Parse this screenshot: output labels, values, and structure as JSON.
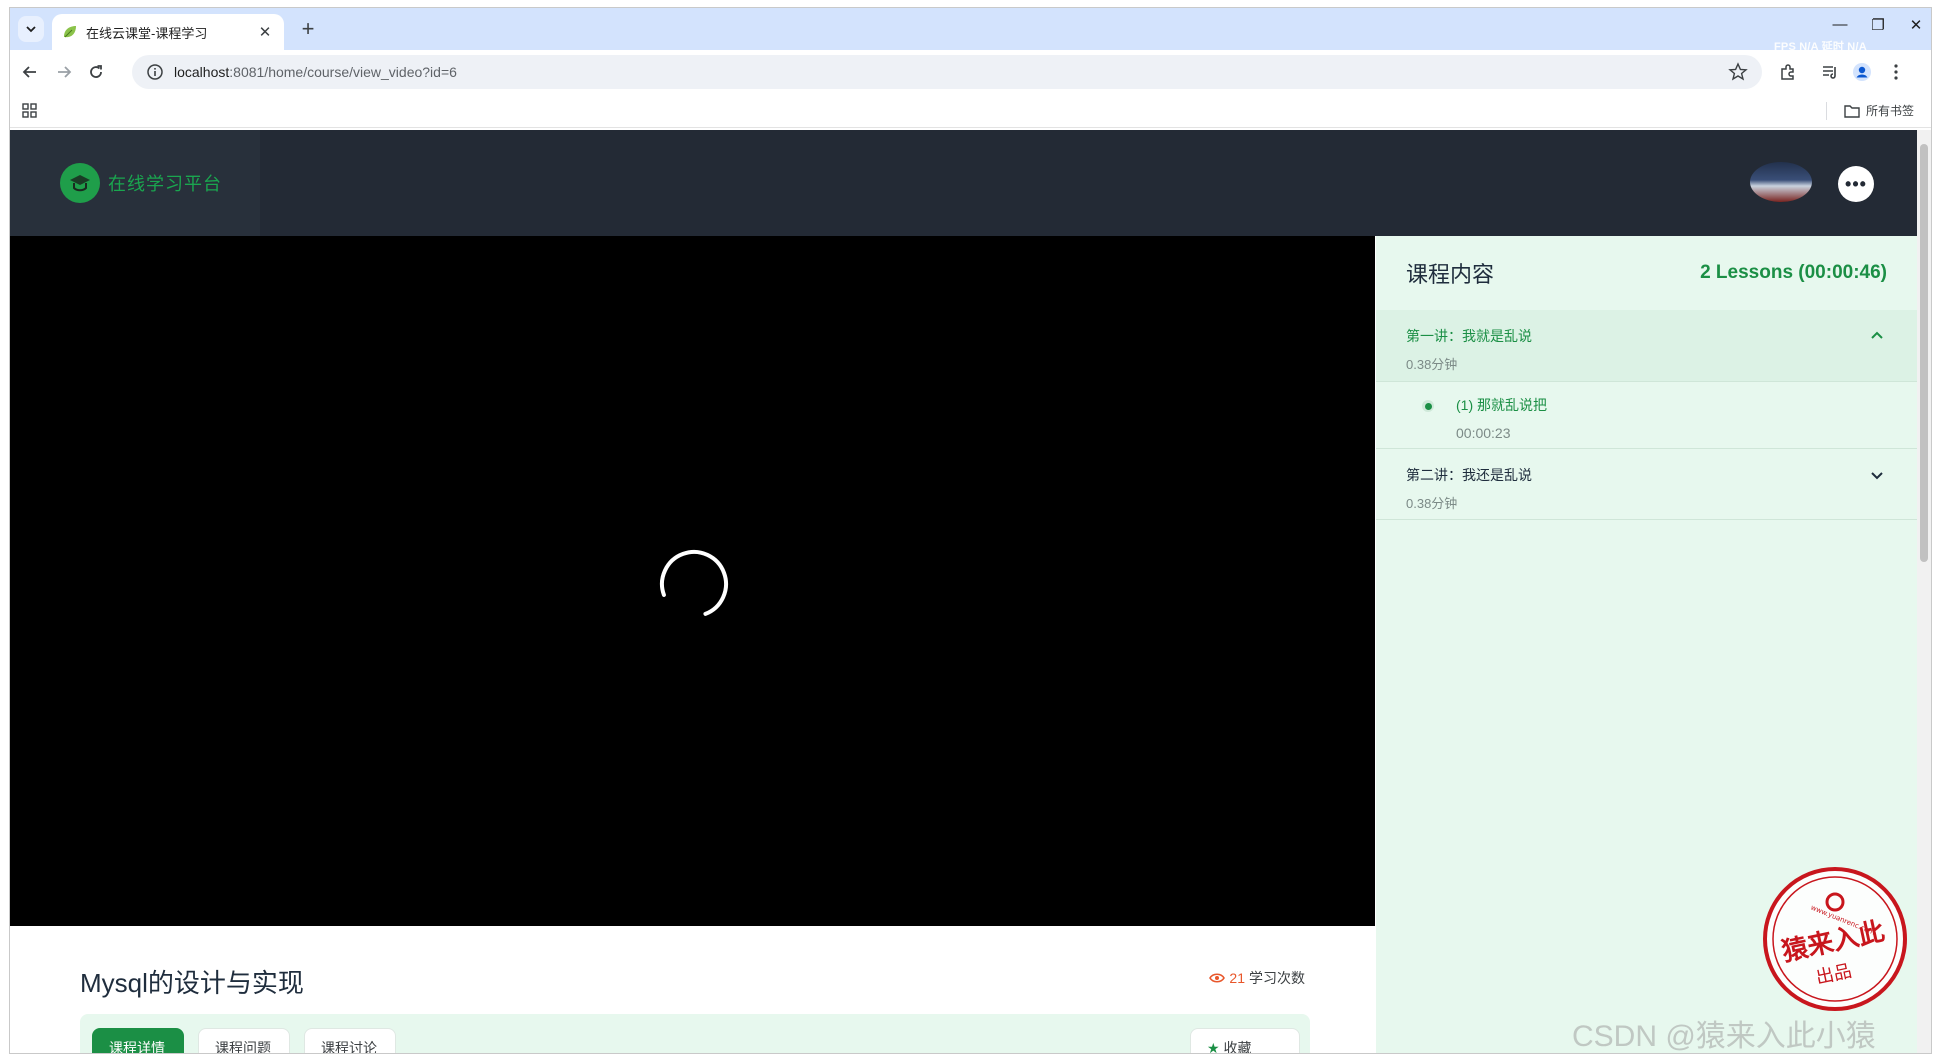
{
  "browser": {
    "tab_title": "在线云课堂-课程学习",
    "url_host": "localhost",
    "url_rest": ":8081/home/course/view_video?id=6",
    "fps_overlay": "FPS N/A 延时 N/A",
    "bookmarks_all": "所有书签",
    "icons": [
      "chevron-down-icon",
      "leaf-favicon",
      "close-icon",
      "plus-icon",
      "back-icon",
      "forward-icon",
      "reload-icon",
      "info-icon",
      "star-icon",
      "extensions-icon",
      "media-icon",
      "profile-icon",
      "kebab-icon",
      "apps-icon",
      "folder-icon"
    ]
  },
  "site": {
    "brand_name": "在线学习平台",
    "more_label": "•••",
    "accent": "#1b8f45"
  },
  "panel": {
    "title": "课程内容",
    "summary": "2 Lessons (00:00:46)",
    "sections": [
      {
        "title": "第一讲：我就是乱说",
        "duration": "0.38分钟",
        "expanded": true,
        "lessons": [
          {
            "title": "(1) 那就乱说把",
            "time": "00:00:23"
          }
        ]
      },
      {
        "title": "第二讲：我还是乱说",
        "duration": "0.38分钟",
        "expanded": false,
        "lessons": []
      }
    ]
  },
  "course": {
    "title": "Mysql的设计与实现",
    "study_count": "21",
    "study_label": "学习次数",
    "tabs": [
      "课程详情",
      "课程问题",
      "课程讨论"
    ],
    "right_tab": "收藏"
  },
  "watermark": {
    "stamp_text": "猿来入此",
    "stamp_sub": "出品",
    "stamp_url": "www.yuanrenc.com",
    "csdn": "CSDN @猿来入此小猿"
  }
}
